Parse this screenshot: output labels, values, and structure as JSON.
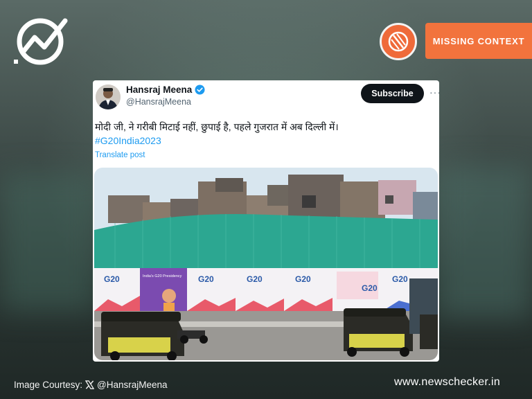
{
  "brand": {
    "logo_icon": "newschecker-logo-icon",
    "website": "www.newschecker.in"
  },
  "verdict": {
    "icon": "missing-context-icon",
    "label": "MISSING CONTEXT",
    "color": "#f2733d"
  },
  "tweet": {
    "author_name": "Hansraj Meena",
    "author_handle": "@HansrajMeena",
    "verified_icon": "verified-badge-icon",
    "subscribe_label": "Subscribe",
    "more_label": "···",
    "text": "मोदी जी, ने गरीबी मिटाई नहीं, छुपाई है, पहले गुजरात में अब दिल्ली में।",
    "hashtag": "#G20India2023",
    "translate_label": "Translate post",
    "photo": {
      "banner_text": "G20",
      "banner_caption": "India's G20 Presidency"
    }
  },
  "footer": {
    "credit_prefix": "Image Courtesy:",
    "x_icon": "x-logo-icon",
    "credit_handle": "@HansrajMeena"
  }
}
